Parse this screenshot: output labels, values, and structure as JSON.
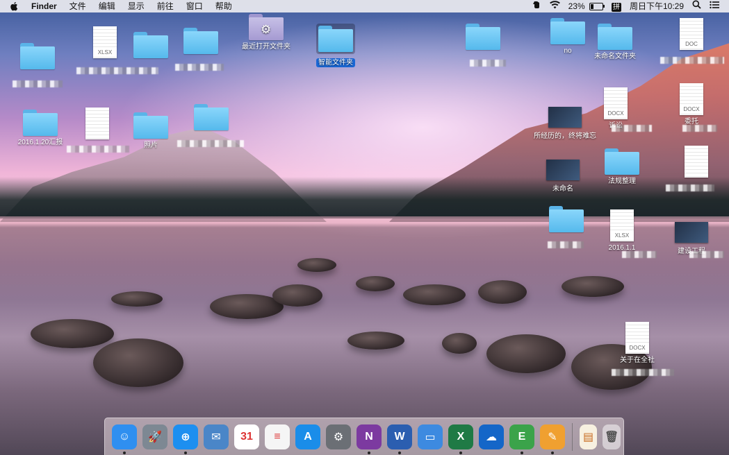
{
  "menubar": {
    "app": "Finder",
    "menus": [
      "文件",
      "编辑",
      "显示",
      "前往",
      "窗口",
      "帮助"
    ],
    "battery_percent": "23%",
    "battery_level": 0.23,
    "input_method": "拼",
    "clock": "周日下午10:29"
  },
  "desktop": {
    "recent_folder_label": "最近打开文件夹",
    "smart_folder_label": "智能文件夹",
    "no_label": "no",
    "untitled_folder_label": "未命名文件夹",
    "report_label": "2016.1.20汇报",
    "photos_label": "照片",
    "experience_label": "所经历的，终将难忘",
    "untitled_label": "未命名",
    "regulations_label": "法规整理",
    "xlsx_label_partial": "2016.1.1",
    "construction_label_partial": "建设工程",
    "about_label_partial": "关于在全社",
    "lawsuit_label_partial": "诉讼",
    "commission_label_partial": "委托",
    "xlsx_tag": "XLSX",
    "docx_tag": "DOCX",
    "doc_tag": "DOC"
  },
  "dock": {
    "apps": [
      {
        "name": "Finder",
        "glyph": "☺",
        "color": "#2f8ff0",
        "running": true
      },
      {
        "name": "Launchpad",
        "glyph": "🚀",
        "color": "#7d8893",
        "running": false
      },
      {
        "name": "Safari",
        "glyph": "⊕",
        "color": "#1d8ff0",
        "running": true
      },
      {
        "name": "Mail",
        "glyph": "✉",
        "color": "#4a86c8",
        "running": false
      },
      {
        "name": "Calendar",
        "glyph": "31",
        "color": "#ffffff",
        "running": false
      },
      {
        "name": "Reminders",
        "glyph": "≡",
        "color": "#f5f5f5",
        "running": false
      },
      {
        "name": "App Store",
        "glyph": "A",
        "color": "#1a8de9",
        "running": false
      },
      {
        "name": "System Preferences",
        "glyph": "⚙",
        "color": "#6b6f75",
        "running": false
      },
      {
        "name": "OneNote",
        "glyph": "N",
        "color": "#7c3aa0",
        "running": true
      },
      {
        "name": "Word",
        "glyph": "W",
        "color": "#2b5eb0",
        "running": true
      },
      {
        "name": "Keynote",
        "glyph": "▭",
        "color": "#3d8ae0",
        "running": false
      },
      {
        "name": "Excel",
        "glyph": "X",
        "color": "#1f7a45",
        "running": true
      },
      {
        "name": "OneDrive",
        "glyph": "☁",
        "color": "#1466c8",
        "running": false
      },
      {
        "name": "Evernote",
        "glyph": "E",
        "color": "#3ba34a",
        "running": true
      },
      {
        "name": "Pages",
        "glyph": "✎",
        "color": "#f0a030",
        "running": true
      }
    ],
    "stack_glyph": "▤",
    "trash_glyph": "🗑"
  }
}
